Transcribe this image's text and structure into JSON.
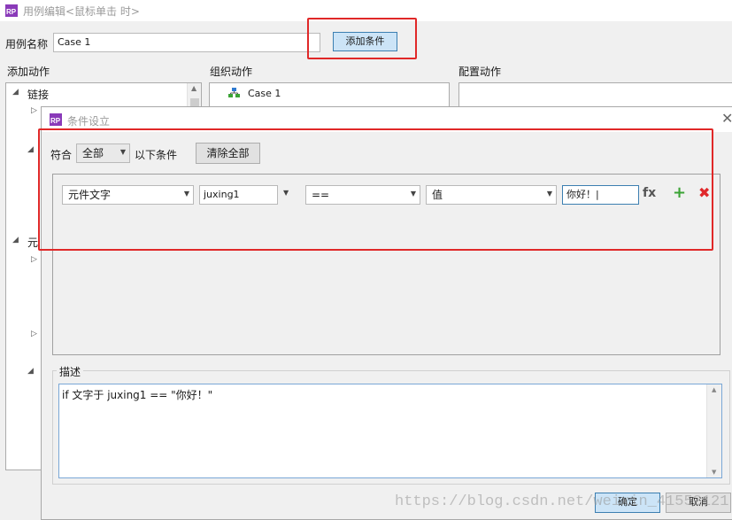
{
  "case_editor": {
    "title": "用例编辑<鼠标单击 时>",
    "case_name_label": "用例名称",
    "case_name_value": "Case 1",
    "add_condition_button": "添加条件",
    "add_action_heading": "添加动作",
    "organize_action_heading": "组织动作",
    "configure_action_heading": "配置动作",
    "tree_link": "链接",
    "tree_widget_partial": "元",
    "organize_case": "Case 1"
  },
  "condition_dialog": {
    "title": "条件设立",
    "match_label": "符合",
    "match_value": "全部",
    "match_suffix": "以下条件",
    "clear_all_button": "清除全部",
    "condition_row": {
      "target_type": "元件文字",
      "target_widget": "juxing1",
      "operator": "==",
      "value_type": "值",
      "value": "你好！|",
      "fx_label": "fx"
    },
    "description_label": "描述",
    "description_text": "if 文字于 juxing1 == \"你好！\"",
    "ok_button": "确定",
    "cancel_button": "取消"
  },
  "watermark": "https://blog.csdn.net/weixin_41552121",
  "colors": {
    "highlight": "#e02828",
    "add_icon": "#3aa335",
    "delete_icon": "#e0282b",
    "logo": "#8a3ab9"
  }
}
